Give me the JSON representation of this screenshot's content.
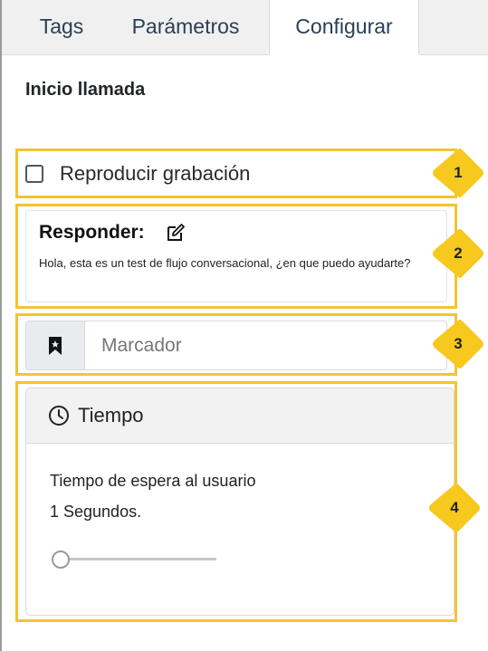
{
  "tabs": [
    {
      "label": "Tags",
      "active": false
    },
    {
      "label": "Parámetros",
      "active": false
    },
    {
      "label": "Configurar",
      "active": true
    }
  ],
  "section_title": "Inicio llamada",
  "play_recording": {
    "label": "Reproducir grabación",
    "checked": false
  },
  "respond": {
    "title": "Responder:",
    "icon": "edit-icon",
    "text": "Hola, esta es un test de flujo conversacional, ¿en que puedo ayudarte?"
  },
  "bookmark": {
    "icon": "bookmark-icon",
    "placeholder": "Marcador",
    "value": ""
  },
  "time": {
    "icon": "clock-icon",
    "title": "Tiempo",
    "wait_label": "Tiempo de espera al usuario",
    "wait_value": "1 Segundos.",
    "slider_fraction": 0
  },
  "callouts": [
    "1",
    "2",
    "3",
    "4"
  ],
  "colors": {
    "highlight": "#f4c430",
    "badge": "#f7c81e"
  }
}
